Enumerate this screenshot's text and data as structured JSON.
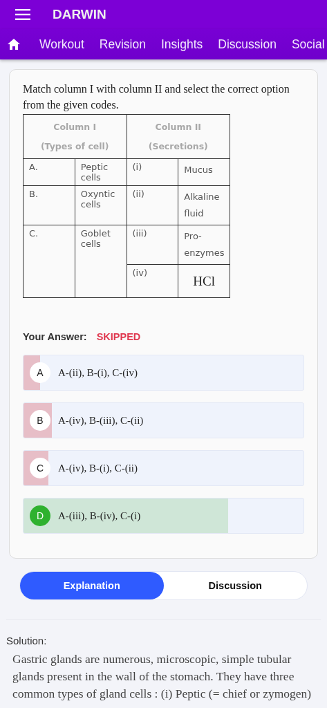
{
  "app_bar": {
    "title": "DARWIN"
  },
  "tabs": [
    {
      "label": "Workout",
      "selected": false
    },
    {
      "label": "Revision",
      "selected": false
    },
    {
      "label": "Insights",
      "selected": false
    },
    {
      "label": "Discussion",
      "selected": false
    },
    {
      "label": "Social",
      "selected": false
    }
  ],
  "question": {
    "text": "Match column I with column II and select the correct option from the given codes.",
    "table": {
      "headers": [
        [
          "Column I",
          "(Types of cell)"
        ],
        [
          "Column II",
          "(Secretions)"
        ]
      ],
      "rows": [
        {
          "label": "A.",
          "cell": "Peptic cells",
          "numeral": "(i)",
          "secretion": "Mucus",
          "kind": "text"
        },
        {
          "label": "B.",
          "cell": "Oxyntic cells",
          "numeral": "(ii)",
          "secretion": "Alkaline fluid",
          "kind": "text"
        },
        {
          "label": "C.",
          "cell": "Goblet cells",
          "numeral": "(iii)",
          "secretion": "Pro-enzymes",
          "kind": "text"
        },
        {
          "numeral": "(iv)",
          "secretion": "HCl",
          "kind": "formula"
        }
      ]
    }
  },
  "your_answer": {
    "label": "Your Answer:",
    "value": "SKIPPED"
  },
  "options": [
    {
      "letter": "A",
      "text": "A-(ii), B-(i), C-(iv)",
      "correct": false,
      "level": 0.06
    },
    {
      "letter": "B",
      "text": "A-(iv), B-(iii), C-(ii)",
      "correct": false,
      "level": 0.1
    },
    {
      "letter": "C",
      "text": "A-(iv), B-(i), C-(ii)",
      "correct": false,
      "level": 0.09
    },
    {
      "letter": "D",
      "text": "A-(iii), B-(iv), C-(i)",
      "correct": true,
      "level": 0.73
    }
  ],
  "segments": [
    {
      "label": "Explanation",
      "selected": true
    },
    {
      "label": "Discussion",
      "selected": false
    }
  ],
  "solution": {
    "heading": "Solution:",
    "text": "Gastric glands are numerous, microscopic, simple tubular glands present in the wall of the stomach. They have three common types of gland cells : (i) Peptic (= chief or zymogen)"
  }
}
